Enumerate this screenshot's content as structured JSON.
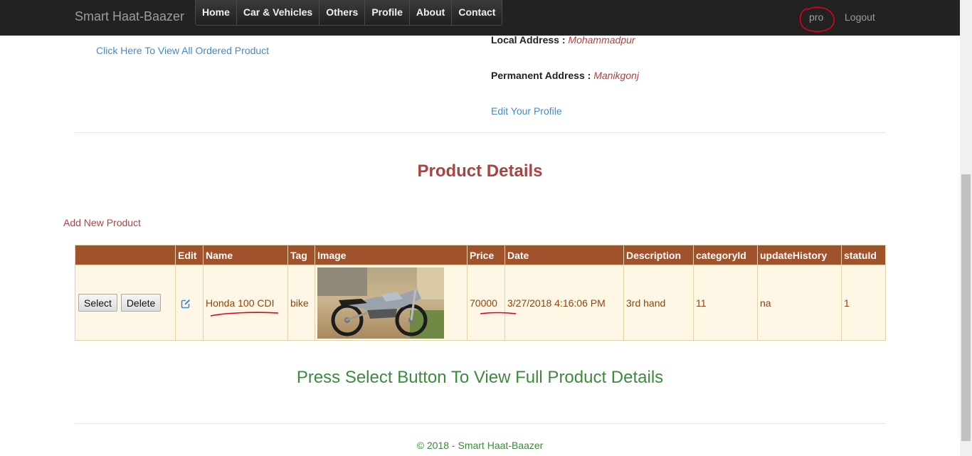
{
  "navbar": {
    "brand": "Smart Haat-Baazer",
    "menu": [
      "Home",
      "Car & Vehicles",
      "Others",
      "Profile",
      "About",
      "Contact"
    ],
    "user": "pro",
    "logout": "Logout"
  },
  "profile": {
    "ordered_link": "Click Here To View All Ordered Product",
    "local_label": "Local Address :",
    "local_value": "Mohammadpur",
    "permanent_label": "Permanent Address :",
    "permanent_value": "Manikgonj",
    "edit_link": "Edit Your Profile"
  },
  "products": {
    "title": "Product Details",
    "add_link": "Add New Product",
    "columns": [
      "",
      "Edit",
      "Name",
      "Tag",
      "Image",
      "Price",
      "Date",
      "Description",
      "categoryId",
      "updateHistory",
      "statuId"
    ],
    "rows": [
      {
        "select_label": "Select",
        "delete_label": "Delete",
        "edit_icon": "edit-icon",
        "name": "Honda 100 CDI",
        "tag": "bike",
        "image": "motorcycle-photo",
        "price": "70000",
        "date": "3/27/2018 4:16:06 PM",
        "description": "3rd hand",
        "categoryId": "11",
        "updateHistory": "na",
        "statuId": "1"
      }
    ],
    "press_message": "Press Select Button To View Full Product Details"
  },
  "footer": "© 2018 - Smart Haat-Baazer",
  "colors": {
    "navbar_bg": "#222222",
    "header_bg": "#a0522d",
    "row_bg": "#fff7e5",
    "accent_red": "#a94442",
    "link_blue": "#428bca",
    "message_green": "#3c8a3c",
    "annotation_red": "#e0001b"
  }
}
